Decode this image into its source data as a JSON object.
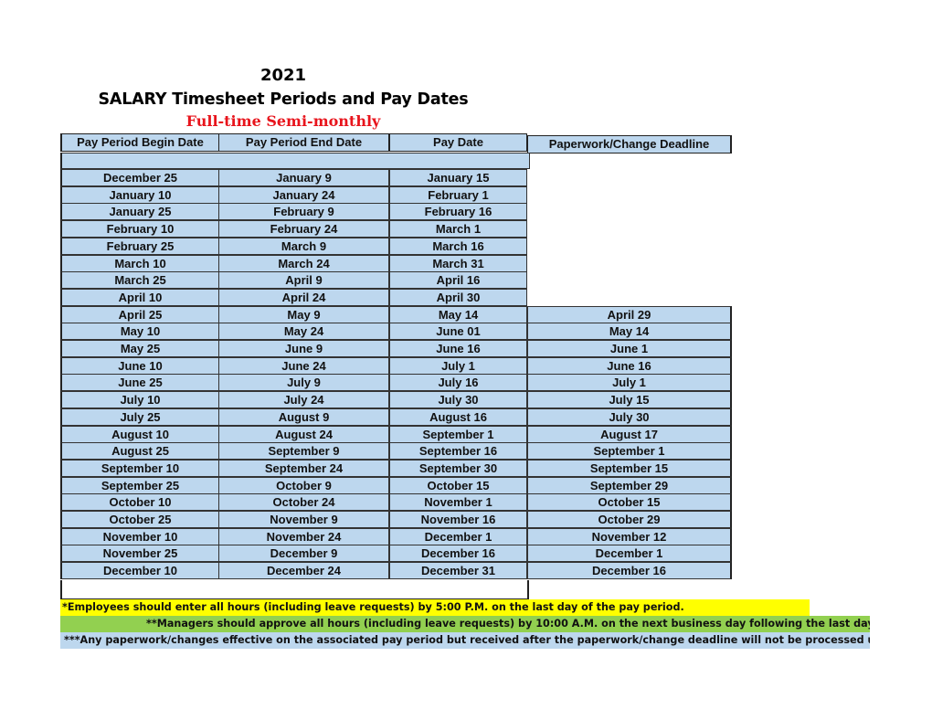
{
  "title": {
    "year": "2021",
    "main": "SALARY Timesheet Periods and Pay Dates",
    "subtitle": "Full-time Semi-monthly"
  },
  "colors": {
    "cell_fill": "#bdd7ee",
    "subtitle": "#e8141c",
    "note1_bg": "#ffff00",
    "note2_bg": "#92d050",
    "note3_bg": "#bdd7ee"
  },
  "table": {
    "headers": [
      "Pay Period Begin Date",
      "Pay Period End Date",
      "Pay Date",
      "Paperwork/Change Deadline"
    ],
    "rows": [
      [
        "December 25",
        "January 9",
        "January 15",
        ""
      ],
      [
        "January 10",
        "January 24",
        "February 1",
        ""
      ],
      [
        "January 25",
        "February 9",
        "February 16",
        ""
      ],
      [
        "February 10",
        "February 24",
        "March 1",
        ""
      ],
      [
        "February 25",
        "March 9",
        "March 16",
        ""
      ],
      [
        "March 10",
        "March 24",
        "March 31",
        ""
      ],
      [
        "March 25",
        "April 9",
        "April 16",
        ""
      ],
      [
        "April 10",
        "April 24",
        "April 30",
        ""
      ],
      [
        "April 25",
        "May 9",
        "May 14",
        "April 29"
      ],
      [
        "May 10",
        "May 24",
        "June 01",
        "May 14"
      ],
      [
        "May 25",
        "June 9",
        "June 16",
        "June 1"
      ],
      [
        "June 10",
        "June 24",
        "July 1",
        "June 16"
      ],
      [
        "June 25",
        "July 9",
        "July 16",
        "July 1"
      ],
      [
        "July 10",
        "July 24",
        "July 30",
        "July 15"
      ],
      [
        "July 25",
        "August 9",
        "August 16",
        "July 30"
      ],
      [
        "August 10",
        "August 24",
        "September 1",
        "August 17"
      ],
      [
        "August 25",
        "September 9",
        "September 16",
        "September 1"
      ],
      [
        "September 10",
        "September 24",
        "September 30",
        "September 15"
      ],
      [
        "September 25",
        "October 9",
        "October 15",
        "September 29"
      ],
      [
        "October 10",
        "October 24",
        "November 1",
        "October 15"
      ],
      [
        "October 25",
        "November 9",
        "November 16",
        "October 29"
      ],
      [
        "November 10",
        "November 24",
        "December 1",
        "November 12"
      ],
      [
        "November 25",
        "December 9",
        "December 16",
        "December 1"
      ],
      [
        "December 10",
        "December 24",
        "December 31",
        "December 16"
      ]
    ]
  },
  "notes": [
    "*Employees should enter all hours (including leave requests) by 5:00 P.M. on the last day of the pay period.",
    "**Managers should approve all hours (including leave requests) by 10:00 A.M. on the next business day following the last day of the pay period.",
    "***Any paperwork/changes effective on the associated pay period but received after the paperwork/change deadline will not be processed until the following pay period."
  ]
}
